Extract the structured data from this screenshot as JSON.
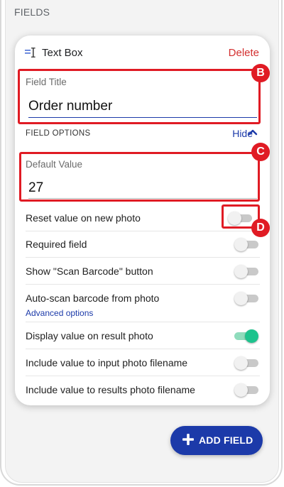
{
  "section": {
    "title": "FIELDS"
  },
  "card": {
    "type_label": "Text Box",
    "type_icon": "text-box-icon",
    "delete_label": "Delete",
    "field_title": {
      "label": "Field Title",
      "value": "Order number"
    },
    "options_header": "FIELD OPTIONS",
    "hide_label": "Hide",
    "default_value": {
      "label": "Default Value",
      "value": "27"
    },
    "options": [
      {
        "label": "Reset value on new photo",
        "on": false
      },
      {
        "label": "Required field",
        "on": false
      },
      {
        "label": "Show \"Scan Barcode\" button",
        "on": false
      },
      {
        "label": "Auto-scan barcode from photo",
        "on": false,
        "link": "Advanced options"
      },
      {
        "label": "Display value on result photo",
        "on": true
      },
      {
        "label": "Include value to input photo filename",
        "on": false
      },
      {
        "label": "Include value to results photo filename",
        "on": false
      }
    ]
  },
  "add_field": {
    "label": "ADD FIELD"
  },
  "callouts": {
    "B": "B",
    "C": "C",
    "D": "D"
  },
  "colors": {
    "accent": "#1c3aa9",
    "delete": "#d32f2f",
    "highlight": "#e01b24",
    "toggle_on": "#1dc38d"
  }
}
